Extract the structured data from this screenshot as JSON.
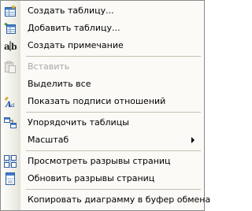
{
  "menu": {
    "items": [
      {
        "label": "Создать таблицу...",
        "icon": "new-table-icon"
      },
      {
        "label": "Добавить таблицу...",
        "icon": "add-table-icon"
      },
      {
        "label": "Создать примечание",
        "icon": "text-annotation-icon",
        "icon_text": "a|b"
      },
      {
        "label": "Вставить",
        "icon": "paste-icon",
        "disabled": true
      },
      {
        "label": "Выделить все",
        "icon": ""
      },
      {
        "label": "Показать подписи отношений",
        "icon": "relationship-labels-icon",
        "icon_text": "Aa"
      },
      {
        "label": "Упорядочить таблицы",
        "icon": "arrange-tables-icon"
      },
      {
        "label": "Масштаб",
        "icon": "",
        "submenu": true
      },
      {
        "label": "Просмотреть разрывы страниц",
        "icon": "view-page-breaks-icon"
      },
      {
        "label": "Обновить разрывы страниц",
        "icon": "refresh-page-breaks-icon"
      },
      {
        "label": "Копировать диаграмму в буфер обмена",
        "icon": ""
      }
    ]
  }
}
